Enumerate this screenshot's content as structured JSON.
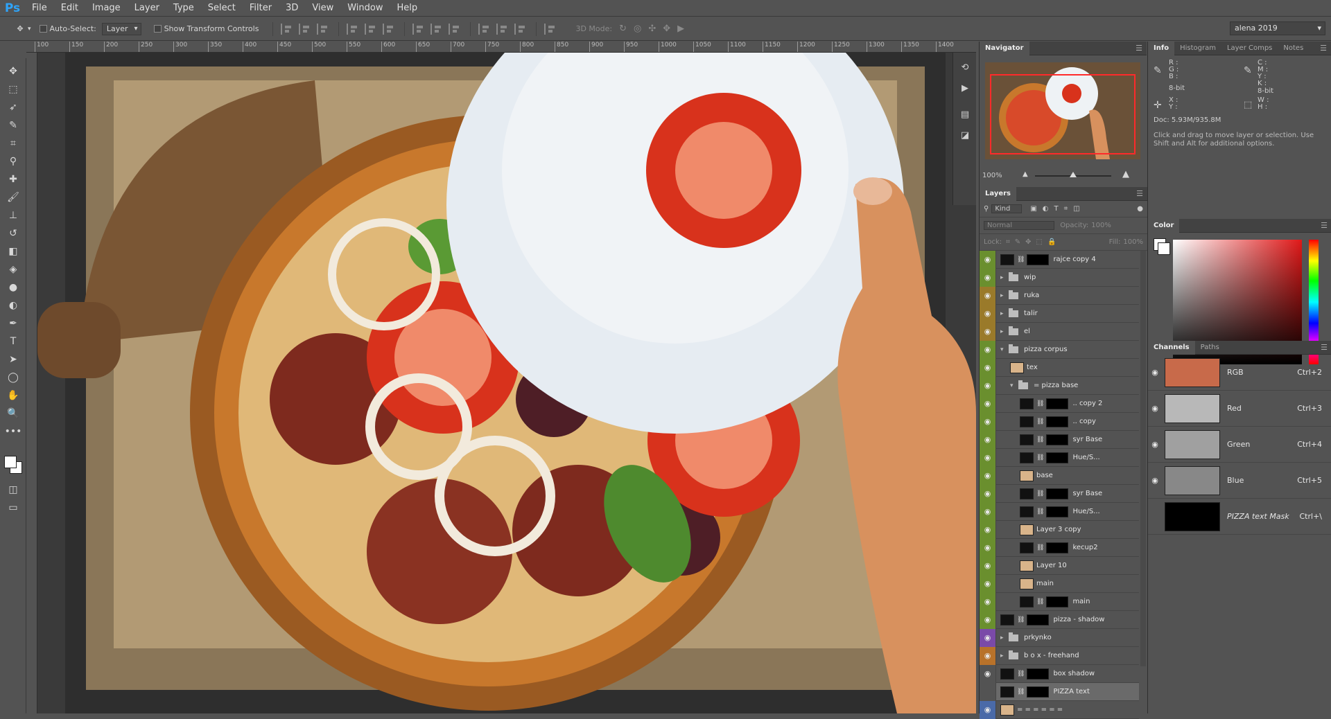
{
  "menubar": {
    "logo": "Ps",
    "items": [
      "File",
      "Edit",
      "Image",
      "Layer",
      "Type",
      "Select",
      "Filter",
      "3D",
      "View",
      "Window",
      "Help"
    ]
  },
  "options": {
    "auto_select_label": "Auto-Select:",
    "auto_select_target": "Layer",
    "transform_label": "Show Transform Controls",
    "mode_3d_label": "3D Mode:",
    "workspace": "alena 2019"
  },
  "ruler": {
    "ticks": [
      "100",
      "150",
      "200",
      "250",
      "300",
      "350",
      "400",
      "450",
      "500",
      "550",
      "600",
      "650",
      "700",
      "750",
      "800",
      "850",
      "900",
      "950",
      "1000",
      "1050",
      "1100",
      "1150",
      "1200",
      "1250",
      "1300",
      "1350",
      "1400"
    ]
  },
  "navigator": {
    "tab": "Navigator",
    "zoom": "100%"
  },
  "layers": {
    "tab": "Layers",
    "kind": "Kind",
    "blend": "Normal",
    "opacity_label": "Opacity:",
    "opacity": "100%",
    "lock_label": "Lock:",
    "fill_label": "Fill:",
    "fill": "100%",
    "rows": [
      {
        "name": "rajce copy 4",
        "indent": 0,
        "kind": "mask",
        "color": "#6a8f2e"
      },
      {
        "name": "wip",
        "indent": 0,
        "kind": "folder",
        "color": "#6a8f2e"
      },
      {
        "name": "ruka",
        "indent": 0,
        "kind": "folder",
        "color": "#9a7a2a"
      },
      {
        "name": "talir",
        "indent": 0,
        "kind": "folder",
        "color": "#9a7a2a"
      },
      {
        "name": "el",
        "indent": 0,
        "kind": "folder",
        "color": "#9a7a2a"
      },
      {
        "name": "pizza corpus",
        "indent": 0,
        "kind": "folder-open",
        "color": "#6a8f2e"
      },
      {
        "name": "tex",
        "indent": 1,
        "kind": "thumb",
        "color": "#6a8f2e"
      },
      {
        "name": "= pizza base",
        "indent": 1,
        "kind": "folder-open",
        "color": "#6a8f2e"
      },
      {
        "name": ".. copy 2",
        "indent": 2,
        "kind": "mask",
        "color": "#6a8f2e"
      },
      {
        "name": ".. copy",
        "indent": 2,
        "kind": "mask",
        "color": "#6a8f2e"
      },
      {
        "name": "syr Base",
        "indent": 2,
        "kind": "mask",
        "color": "#6a8f2e"
      },
      {
        "name": "Hue/S...",
        "indent": 2,
        "kind": "mask",
        "color": "#6a8f2e"
      },
      {
        "name": "base",
        "indent": 2,
        "kind": "thumb",
        "color": "#6a8f2e"
      },
      {
        "name": "syr Base",
        "indent": 2,
        "kind": "mask",
        "color": "#6a8f2e"
      },
      {
        "name": "Hue/S...",
        "indent": 2,
        "kind": "mask",
        "color": "#6a8f2e"
      },
      {
        "name": "Layer 3 copy",
        "indent": 2,
        "kind": "thumb",
        "color": "#6a8f2e"
      },
      {
        "name": "kecup2",
        "indent": 2,
        "kind": "mask",
        "color": "#6a8f2e"
      },
      {
        "name": "Layer 10",
        "indent": 2,
        "kind": "thumb",
        "color": "#6a8f2e"
      },
      {
        "name": "main",
        "indent": 2,
        "kind": "thumb",
        "color": "#6a8f2e"
      },
      {
        "name": "main",
        "indent": 2,
        "kind": "mask",
        "color": "#6a8f2e"
      },
      {
        "name": "pizza - shadow",
        "indent": 0,
        "kind": "mask",
        "color": "#6a8f2e"
      },
      {
        "name": "prkynko",
        "indent": 0,
        "kind": "folder",
        "color": "#7a4aa8"
      },
      {
        "name": "b o x - freehand",
        "indent": 0,
        "kind": "folder",
        "color": "#b8722a"
      },
      {
        "name": "box shadow",
        "indent": 0,
        "kind": "mask",
        "color": "#535353"
      },
      {
        "name": "PIZZA text",
        "indent": 0,
        "kind": "mask",
        "color": "#535353",
        "selected": true
      },
      {
        "name": "= = = = = =",
        "indent": 0,
        "kind": "thumb",
        "color": "#4a6aa8"
      }
    ]
  },
  "info": {
    "tabs": [
      "Info",
      "Histogram",
      "Layer Comps",
      "Notes"
    ],
    "rgb_labels": "R :\nG :\nB :",
    "cmyk_labels": "C :\nM :\nY :\nK :",
    "bit1": "8-bit",
    "bit2": "8-bit",
    "xy": "X :\nY :",
    "wh": "W :\nH :",
    "doc": "Doc: 5.93M/935.8M",
    "hint": "Click and drag to move layer or selection.  Use Shift and Alt for additional options."
  },
  "color": {
    "tab": "Color"
  },
  "channels": {
    "tabs": [
      "Channels",
      "Paths"
    ],
    "rows": [
      {
        "name": "RGB",
        "key": "Ctrl+2"
      },
      {
        "name": "Red",
        "key": "Ctrl+3"
      },
      {
        "name": "Green",
        "key": "Ctrl+4"
      },
      {
        "name": "Blue",
        "key": "Ctrl+5"
      },
      {
        "name": "PIZZA text Mask",
        "key": "Ctrl+\\"
      }
    ]
  }
}
